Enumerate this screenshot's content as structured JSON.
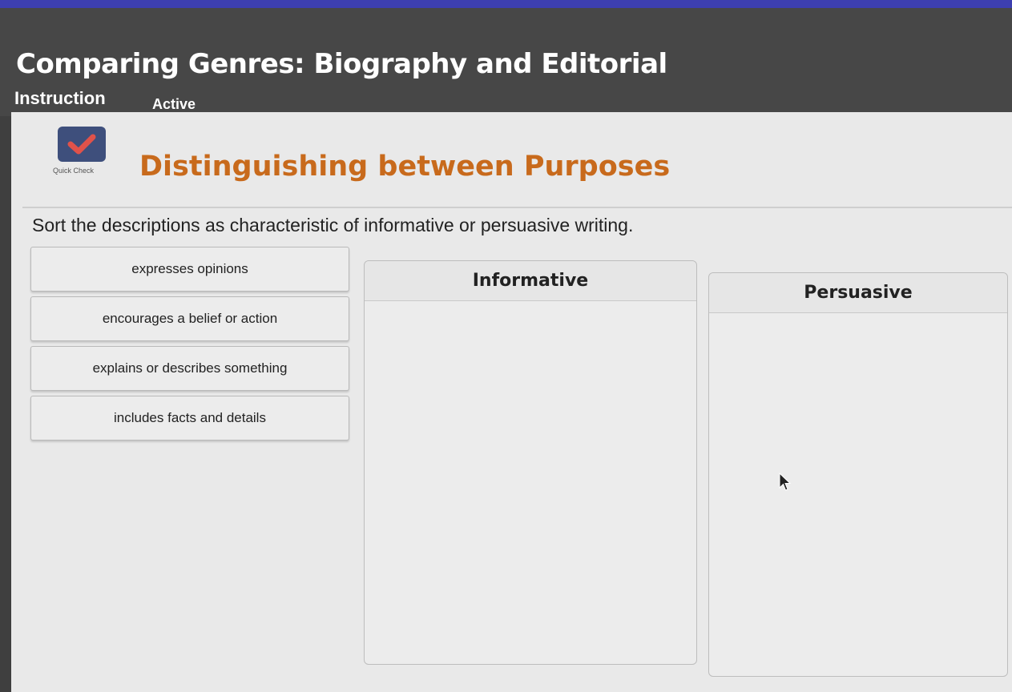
{
  "header": {
    "lesson_title": "Comparing Genres: Biography and Editorial",
    "mode_label": "Instruction",
    "status": "Active"
  },
  "activity": {
    "icon": "checkmark-icon",
    "icon_label": "Quick Check",
    "title": "Distinguishing between Purposes",
    "instructions": "Sort the descriptions as characteristic of informative or persuasive writing."
  },
  "answer_bank": [
    {
      "label": "expresses opinions"
    },
    {
      "label": "encourages a belief or action"
    },
    {
      "label": "explains or describes something"
    },
    {
      "label": "includes facts and details"
    }
  ],
  "columns": [
    {
      "heading": "Informative"
    },
    {
      "heading": "Persuasive"
    }
  ],
  "colors": {
    "accent_orange": "#c86a1c",
    "icon_bg": "#3e4f7c",
    "check_red": "#e0524a",
    "top_bar": "#3d3fb0"
  }
}
